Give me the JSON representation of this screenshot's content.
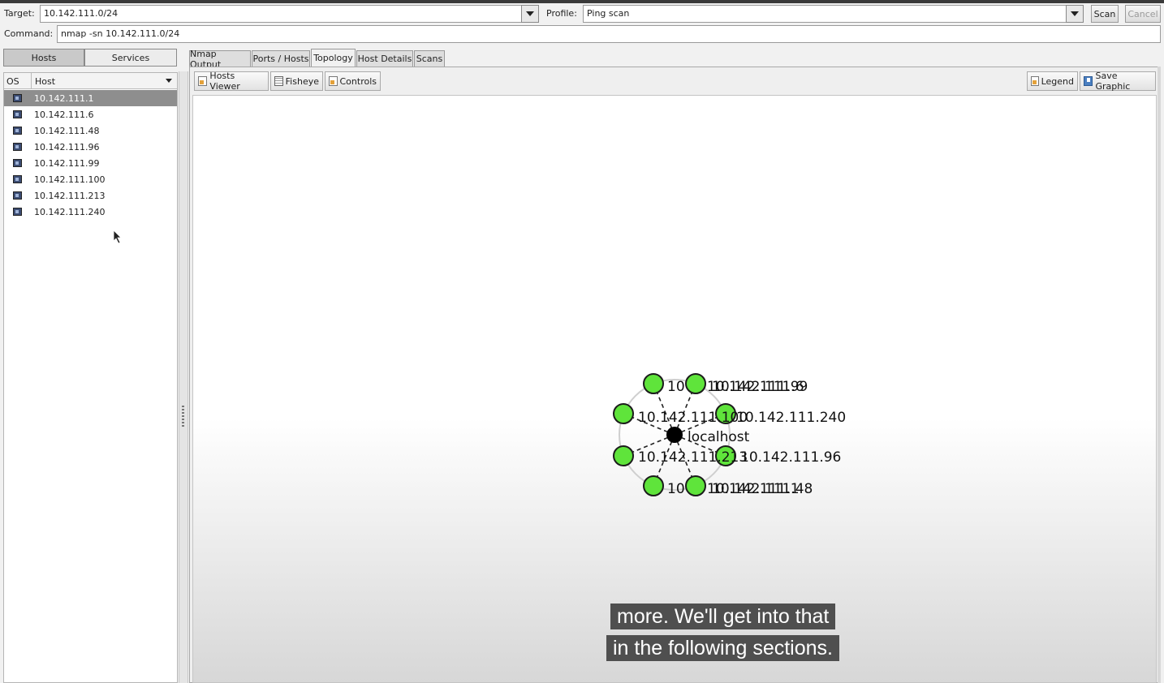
{
  "toolbar": {
    "target_label": "Target:",
    "target_value": "10.142.111.0/24",
    "profile_label": "Profile:",
    "profile_value": "Ping scan",
    "scan_label": "Scan",
    "cancel_label": "Cancel",
    "command_label": "Command:",
    "command_value": "nmap -sn 10.142.111.0/24"
  },
  "left_panel": {
    "toggle_hosts": "Hosts",
    "toggle_services": "Services",
    "col_os": "OS",
    "col_host": "Host",
    "hosts": [
      "10.142.111.1",
      "10.142.111.6",
      "10.142.111.48",
      "10.142.111.96",
      "10.142.111.99",
      "10.142.111.100",
      "10.142.111.213",
      "10.142.111.240"
    ]
  },
  "tabs": [
    "Nmap Output",
    "Ports / Hosts",
    "Topology",
    "Host Details",
    "Scans"
  ],
  "active_tab": "Topology",
  "topology_toolbar": {
    "hosts_viewer": "Hosts Viewer",
    "fisheye": "Fisheye",
    "controls": "Controls",
    "legend": "Legend",
    "save_graphic": "Save Graphic"
  },
  "topology": {
    "center_label": "localhost",
    "node_labels": {
      "top_left": "10",
      "top_right": "10.142.111.6",
      "top_right_overlap": "10.142.111.99",
      "upper_left": "10.142.111.100",
      "upper_right": "10.142.111.240",
      "lower_left": "10.142.111.213",
      "lower_right": "10.142.111.96",
      "bottom_left": "10",
      "bottom_right": "10.142.111.48",
      "bottom_right_overlap": "10.142.111.1"
    }
  },
  "caption": {
    "line1": "more. We'll get into that",
    "line2": "in the following sections."
  },
  "colors": {
    "node_fill": "#5fe43b",
    "center_fill": "#000000",
    "selected_row": "#8e8e8e",
    "caption_bg": "#4f4f4f"
  }
}
